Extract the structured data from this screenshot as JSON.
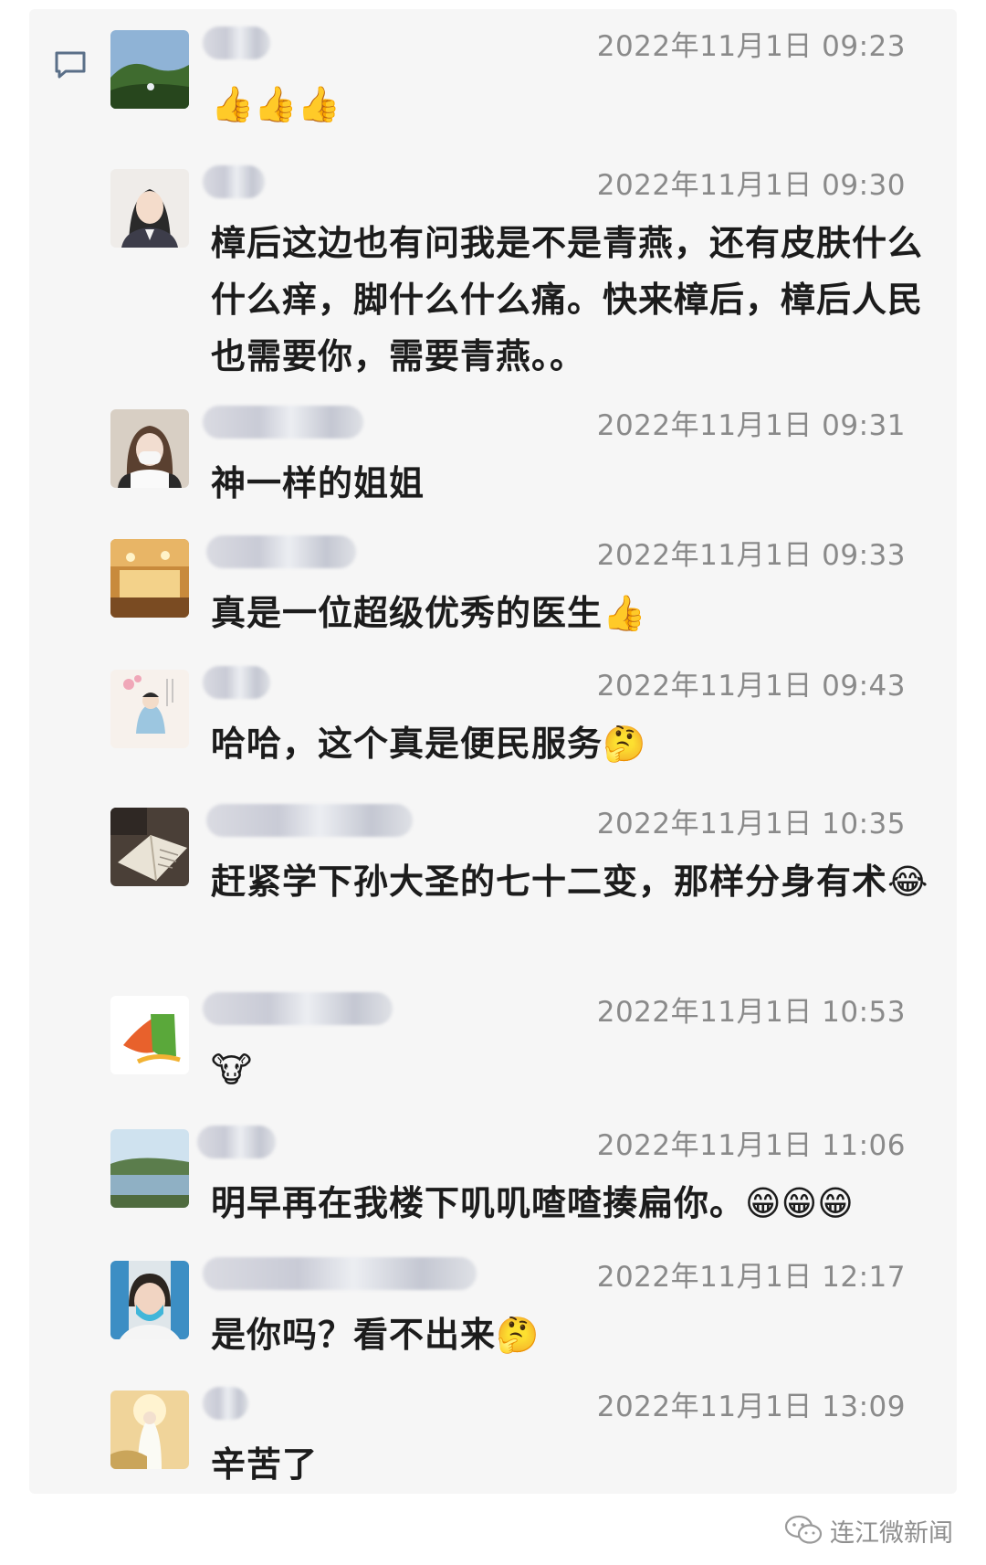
{
  "messages": [
    {
      "time": "2022年11月1日 09:23",
      "text": "",
      "emoji": "👍👍👍"
    },
    {
      "time": "2022年11月1日 09:30",
      "text": "樟后这边也有问我是不是青燕，还有皮肤什么什么痒，脚什么什么痛。快来樟后，樟后人民也需要你，需要青燕。。",
      "emoji": ""
    },
    {
      "time": "2022年11月1日 09:31",
      "text": "神一样的姐姐",
      "emoji": ""
    },
    {
      "time": "2022年11月1日 09:33",
      "text": "真是一位超级优秀的医生",
      "emoji": "👍"
    },
    {
      "time": "2022年11月1日 09:43",
      "text": "哈哈，这个真是便民服务",
      "emoji": "🤔"
    },
    {
      "time": "2022年11月1日 10:35",
      "text": "赶紧学下孙大圣的七十二变，那样分身有术",
      "emoji": "😂"
    },
    {
      "time": "2022年11月1日 10:53",
      "text": "",
      "emoji": "🐮"
    },
    {
      "time": "2022年11月1日 11:06",
      "text": "明早再在我楼下叽叽喳喳揍扁你。",
      "emoji": "😁😁😁"
    },
    {
      "time": "2022年11月1日 12:17",
      "text": "是你吗？看不出来",
      "emoji": "🤔"
    },
    {
      "time": "2022年11月1日 13:09",
      "text": "辛苦了",
      "emoji": ""
    }
  ],
  "watermark": {
    "label": "连江微新闻",
    "icon": "wechat-icon"
  },
  "colors": {
    "panel": "#f6f6f6",
    "time": "#8a8a8a",
    "text": "#1c1c1c"
  }
}
